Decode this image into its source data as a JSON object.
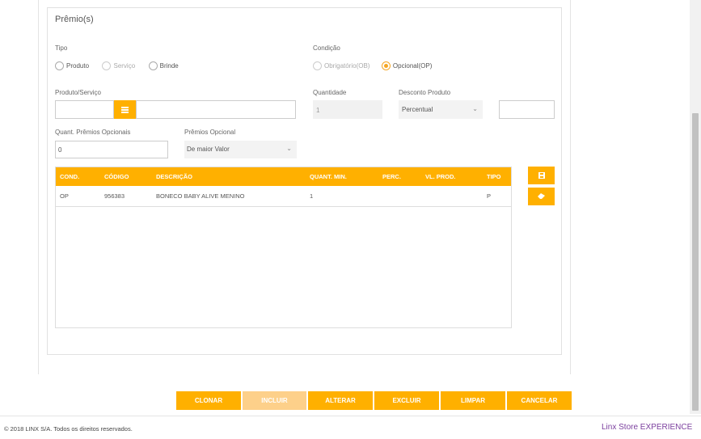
{
  "section": {
    "title": "Prêmio(s)"
  },
  "tipo": {
    "label": "Tipo",
    "options": [
      {
        "label": "Produto",
        "checked": false,
        "disabled": false
      },
      {
        "label": "Serviço",
        "checked": false,
        "disabled": true
      },
      {
        "label": "Brinde",
        "checked": false,
        "disabled": false
      }
    ]
  },
  "condicao": {
    "label": "Condição",
    "options": [
      {
        "label": "Obrigatório(OB)",
        "checked": false,
        "disabled": true
      },
      {
        "label": "Opcional(OP)",
        "checked": true,
        "disabled": false
      }
    ]
  },
  "produto_servico": {
    "label": "Produto/Serviço",
    "code_value": "",
    "desc_value": ""
  },
  "quantidade": {
    "label": "Quantidade",
    "value": "1"
  },
  "desconto_produto": {
    "label": "Desconto Produto",
    "value": "Percentual",
    "extra_value": ""
  },
  "quant_premios": {
    "label": "Quant. Prêmios Opcionais",
    "value": "0"
  },
  "premios_opcional": {
    "label": "Prêmios Opcional",
    "value": "De maior Valor"
  },
  "table": {
    "headers": [
      "COND.",
      "CÓDIGO",
      "DESCRIÇÃO",
      "QUANT. MIN.",
      "PERC.",
      "VL. PROD.",
      "TIPO"
    ],
    "rows": [
      [
        "OP",
        "956383",
        "BONECO BABY ALIVE MENINO",
        "1",
        "",
        "",
        "P"
      ]
    ]
  },
  "side_icons": [
    "save-icon",
    "eraser-icon"
  ],
  "actions": {
    "clonar": "CLONAR",
    "incluir": "INCLUIR",
    "alterar": "ALTERAR",
    "excluir": "EXCLUIR",
    "limpar": "LIMPAR",
    "cancelar": "CANCELAR"
  },
  "footer": {
    "copyright": "© 2018 LINX S/A. Todos os direitos reservados.",
    "brand": "Linx Store EXPERIENCE"
  },
  "colors": {
    "accent": "#ffb000",
    "accent_disabled": "#fdd08a",
    "brand": "#7b3f9e"
  }
}
